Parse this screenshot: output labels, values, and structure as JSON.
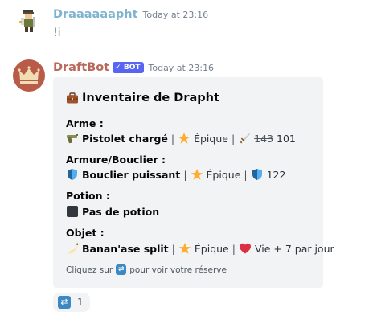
{
  "messages": [
    {
      "username": "Draaaaaapht",
      "timestamp": "Today at 23:16",
      "content": "!i",
      "avatar_icon": "pixel-warrior-icon"
    },
    {
      "username": "DraftBot",
      "bot_badge": "✓ BOT",
      "timestamp": "Today at 23:16",
      "avatar_icon": "crown-icon",
      "embed": {
        "title": "Inventaire de Drapht",
        "title_icon": "briefcase-icon",
        "fields": {
          "weapon": {
            "name": "Arme :",
            "item": "Pistolet chargé",
            "rarity": "Épique",
            "stat_old": "143",
            "stat_new": "101",
            "stat_icon": "dagger-icon"
          },
          "armor": {
            "name": "Armure/Bouclier :",
            "item": "Bouclier puissant",
            "rarity": "Épique",
            "stat": "122",
            "stat_icon": "shield-icon"
          },
          "potion": {
            "name": "Potion :",
            "item": "Pas de potion"
          },
          "object": {
            "name": "Objet :",
            "item": "Banan'ase split",
            "rarity": "Épique",
            "effect": "Vie + 7 par jour",
            "effect_icon": "heart-icon"
          }
        },
        "footer_prefix": "Cliquez sur",
        "footer_suffix": "pour voir votre réserve",
        "footer_icon": "swap-icon"
      },
      "reactions": [
        {
          "emoji": "swap-icon",
          "count": "1"
        }
      ]
    }
  ],
  "colors": {
    "username_user": "#7fb4cf",
    "username_bot": "#b9685a",
    "bot_badge": "#5865f2",
    "embed_bg": "#f2f3f5"
  }
}
